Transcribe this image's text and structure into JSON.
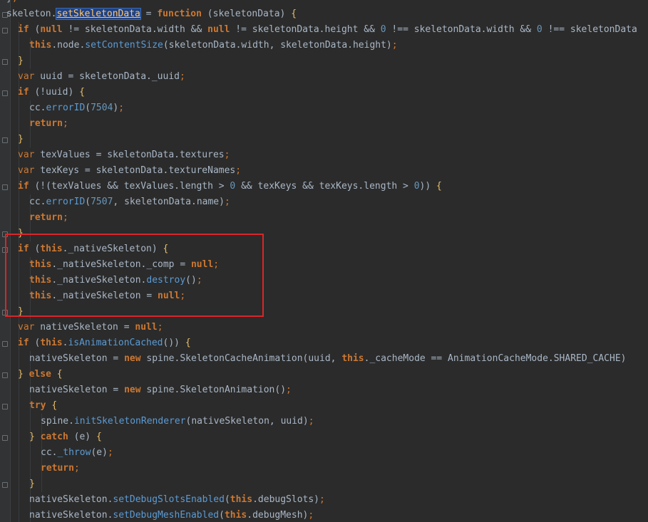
{
  "editor": {
    "language": "javascript",
    "selected_token": "setSkeletonData",
    "annotation_color": "#d9262a",
    "lines": [
      {
        "indent": 1,
        "tokens": [
          [
            "punc",
            "}"
          ],
          [
            "semi",
            ";"
          ]
        ]
      },
      {
        "indent": 1,
        "tokens": [
          [
            "id",
            "skeleton"
          ],
          [
            "punc",
            "."
          ],
          [
            "sel",
            "setSkeletonData"
          ],
          [
            "punc",
            " = "
          ],
          [
            "kw",
            "function"
          ],
          [
            "punc",
            " (skeletonData) "
          ],
          [
            "brace",
            "{"
          ]
        ]
      },
      {
        "indent": 2,
        "tokens": [
          [
            "kw",
            "if"
          ],
          [
            "punc",
            " ("
          ],
          [
            "kw",
            "null"
          ],
          [
            "punc",
            " != skeletonData.width && "
          ],
          [
            "kw",
            "null"
          ],
          [
            "punc",
            " != skeletonData.height && "
          ],
          [
            "num",
            "0"
          ],
          [
            "punc",
            " !== skeletonData.width && "
          ],
          [
            "num",
            "0"
          ],
          [
            "punc",
            " !== skeletonData"
          ]
        ]
      },
      {
        "indent": 3,
        "tokens": [
          [
            "kw",
            "this"
          ],
          [
            "punc",
            ".node."
          ],
          [
            "callname",
            "setContentSize"
          ],
          [
            "punc",
            "(skeletonData.width, skeletonData.height)"
          ],
          [
            "semi",
            ";"
          ]
        ]
      },
      {
        "indent": 2,
        "tokens": [
          [
            "brace",
            "}"
          ]
        ]
      },
      {
        "indent": 2,
        "tokens": [
          [
            "kw-n",
            "var"
          ],
          [
            "punc",
            " uuid = skeletonData._uuid"
          ],
          [
            "semi",
            ";"
          ]
        ]
      },
      {
        "indent": 2,
        "tokens": [
          [
            "kw",
            "if"
          ],
          [
            "punc",
            " (!uuid) "
          ],
          [
            "brace",
            "{"
          ]
        ]
      },
      {
        "indent": 3,
        "tokens": [
          [
            "punc",
            "cc."
          ],
          [
            "callname",
            "errorID"
          ],
          [
            "punc",
            "("
          ],
          [
            "num",
            "7504"
          ],
          [
            "punc",
            ")"
          ],
          [
            "semi",
            ";"
          ]
        ]
      },
      {
        "indent": 3,
        "tokens": [
          [
            "kw",
            "return"
          ],
          [
            "semi",
            ";"
          ]
        ]
      },
      {
        "indent": 2,
        "tokens": [
          [
            "brace",
            "}"
          ]
        ]
      },
      {
        "indent": 2,
        "tokens": [
          [
            "kw-n",
            "var"
          ],
          [
            "punc",
            " texValues = skeletonData.textures"
          ],
          [
            "semi",
            ";"
          ]
        ]
      },
      {
        "indent": 2,
        "tokens": [
          [
            "kw-n",
            "var"
          ],
          [
            "punc",
            " texKeys = skeletonData.textureNames"
          ],
          [
            "semi",
            ";"
          ]
        ]
      },
      {
        "indent": 2,
        "tokens": [
          [
            "kw",
            "if"
          ],
          [
            "punc",
            " (!(texValues && texValues.length > "
          ],
          [
            "num",
            "0"
          ],
          [
            "punc",
            " && texKeys && texKeys.length > "
          ],
          [
            "num",
            "0"
          ],
          [
            "punc",
            "))"
          ],
          [
            "punc",
            " "
          ],
          [
            "brace",
            "{"
          ]
        ]
      },
      {
        "indent": 3,
        "tokens": [
          [
            "punc",
            "cc."
          ],
          [
            "callname",
            "errorID"
          ],
          [
            "punc",
            "("
          ],
          [
            "num",
            "7507"
          ],
          [
            "punc",
            ", skeletonData.name)"
          ],
          [
            "semi",
            ";"
          ]
        ]
      },
      {
        "indent": 3,
        "tokens": [
          [
            "kw",
            "return"
          ],
          [
            "semi",
            ";"
          ]
        ]
      },
      {
        "indent": 2,
        "tokens": [
          [
            "brace",
            "}"
          ]
        ]
      },
      {
        "indent": 2,
        "tokens": [
          [
            "kw",
            "if"
          ],
          [
            "punc",
            " ("
          ],
          [
            "kw",
            "this"
          ],
          [
            "punc",
            "._nativeSkeleton) "
          ],
          [
            "brace",
            "{"
          ]
        ]
      },
      {
        "indent": 3,
        "tokens": [
          [
            "kw",
            "this"
          ],
          [
            "punc",
            "._nativeSkeleton._comp = "
          ],
          [
            "kw",
            "null"
          ],
          [
            "semi",
            ";"
          ]
        ]
      },
      {
        "indent": 3,
        "tokens": [
          [
            "kw",
            "this"
          ],
          [
            "punc",
            "._nativeSkeleton."
          ],
          [
            "callname",
            "destroy"
          ],
          [
            "punc",
            "()"
          ],
          [
            "semi",
            ";"
          ]
        ]
      },
      {
        "indent": 3,
        "tokens": [
          [
            "kw",
            "this"
          ],
          [
            "punc",
            "._nativeSkeleton = "
          ],
          [
            "kw",
            "null"
          ],
          [
            "semi",
            ";"
          ]
        ]
      },
      {
        "indent": 2,
        "tokens": [
          [
            "brace",
            "}"
          ]
        ]
      },
      {
        "indent": 2,
        "tokens": [
          [
            "kw-n",
            "var"
          ],
          [
            "punc",
            " nativeSkeleton = "
          ],
          [
            "kw",
            "null"
          ],
          [
            "semi",
            ";"
          ]
        ]
      },
      {
        "indent": 2,
        "tokens": [
          [
            "kw",
            "if"
          ],
          [
            "punc",
            " ("
          ],
          [
            "kw",
            "this"
          ],
          [
            "punc",
            "."
          ],
          [
            "callname",
            "isAnimationCached"
          ],
          [
            "punc",
            "()) "
          ],
          [
            "brace",
            "{"
          ]
        ]
      },
      {
        "indent": 3,
        "tokens": [
          [
            "punc",
            "nativeSkeleton = "
          ],
          [
            "kw",
            "new"
          ],
          [
            "punc",
            " spine.SkeletonCacheAnimation(uuid, "
          ],
          [
            "kw",
            "this"
          ],
          [
            "punc",
            "._cacheMode == AnimationCacheMode.SHARED_CACHE)"
          ]
        ]
      },
      {
        "indent": 2,
        "tokens": [
          [
            "brace",
            "}"
          ],
          [
            "punc",
            " "
          ],
          [
            "kw",
            "else"
          ],
          [
            "punc",
            " "
          ],
          [
            "brace",
            "{"
          ]
        ]
      },
      {
        "indent": 3,
        "tokens": [
          [
            "punc",
            "nativeSkeleton = "
          ],
          [
            "kw",
            "new"
          ],
          [
            "punc",
            " spine.SkeletonAnimation()"
          ],
          [
            "semi",
            ";"
          ]
        ]
      },
      {
        "indent": 3,
        "tokens": [
          [
            "kw",
            "try"
          ],
          [
            "punc",
            " "
          ],
          [
            "brace",
            "{"
          ]
        ]
      },
      {
        "indent": 4,
        "tokens": [
          [
            "punc",
            "spine."
          ],
          [
            "callname",
            "initSkeletonRenderer"
          ],
          [
            "punc",
            "(nativeSkeleton, uuid)"
          ],
          [
            "semi",
            ";"
          ]
        ]
      },
      {
        "indent": 3,
        "tokens": [
          [
            "brace",
            "}"
          ],
          [
            "punc",
            " "
          ],
          [
            "kw",
            "catch"
          ],
          [
            "punc",
            " (e) "
          ],
          [
            "brace",
            "{"
          ]
        ]
      },
      {
        "indent": 4,
        "tokens": [
          [
            "punc",
            "cc."
          ],
          [
            "callname",
            "_throw"
          ],
          [
            "punc",
            "(e)"
          ],
          [
            "semi",
            ";"
          ]
        ]
      },
      {
        "indent": 4,
        "tokens": [
          [
            "kw",
            "return"
          ],
          [
            "semi",
            ";"
          ]
        ]
      },
      {
        "indent": 3,
        "tokens": [
          [
            "brace",
            "}"
          ]
        ]
      },
      {
        "indent": 3,
        "tokens": [
          [
            "punc",
            "nativeSkeleton."
          ],
          [
            "callname",
            "setDebugSlotsEnabled"
          ],
          [
            "punc",
            "("
          ],
          [
            "kw",
            "this"
          ],
          [
            "punc",
            ".debugSlots)"
          ],
          [
            "semi",
            ";"
          ]
        ]
      },
      {
        "indent": 3,
        "tokens": [
          [
            "punc",
            "nativeSkeleton."
          ],
          [
            "callname",
            "setDebugMeshEnabled"
          ],
          [
            "punc",
            "("
          ],
          [
            "kw",
            "this"
          ],
          [
            "punc",
            ".debugMesh)"
          ],
          [
            "semi",
            ";"
          ]
        ]
      }
    ]
  }
}
